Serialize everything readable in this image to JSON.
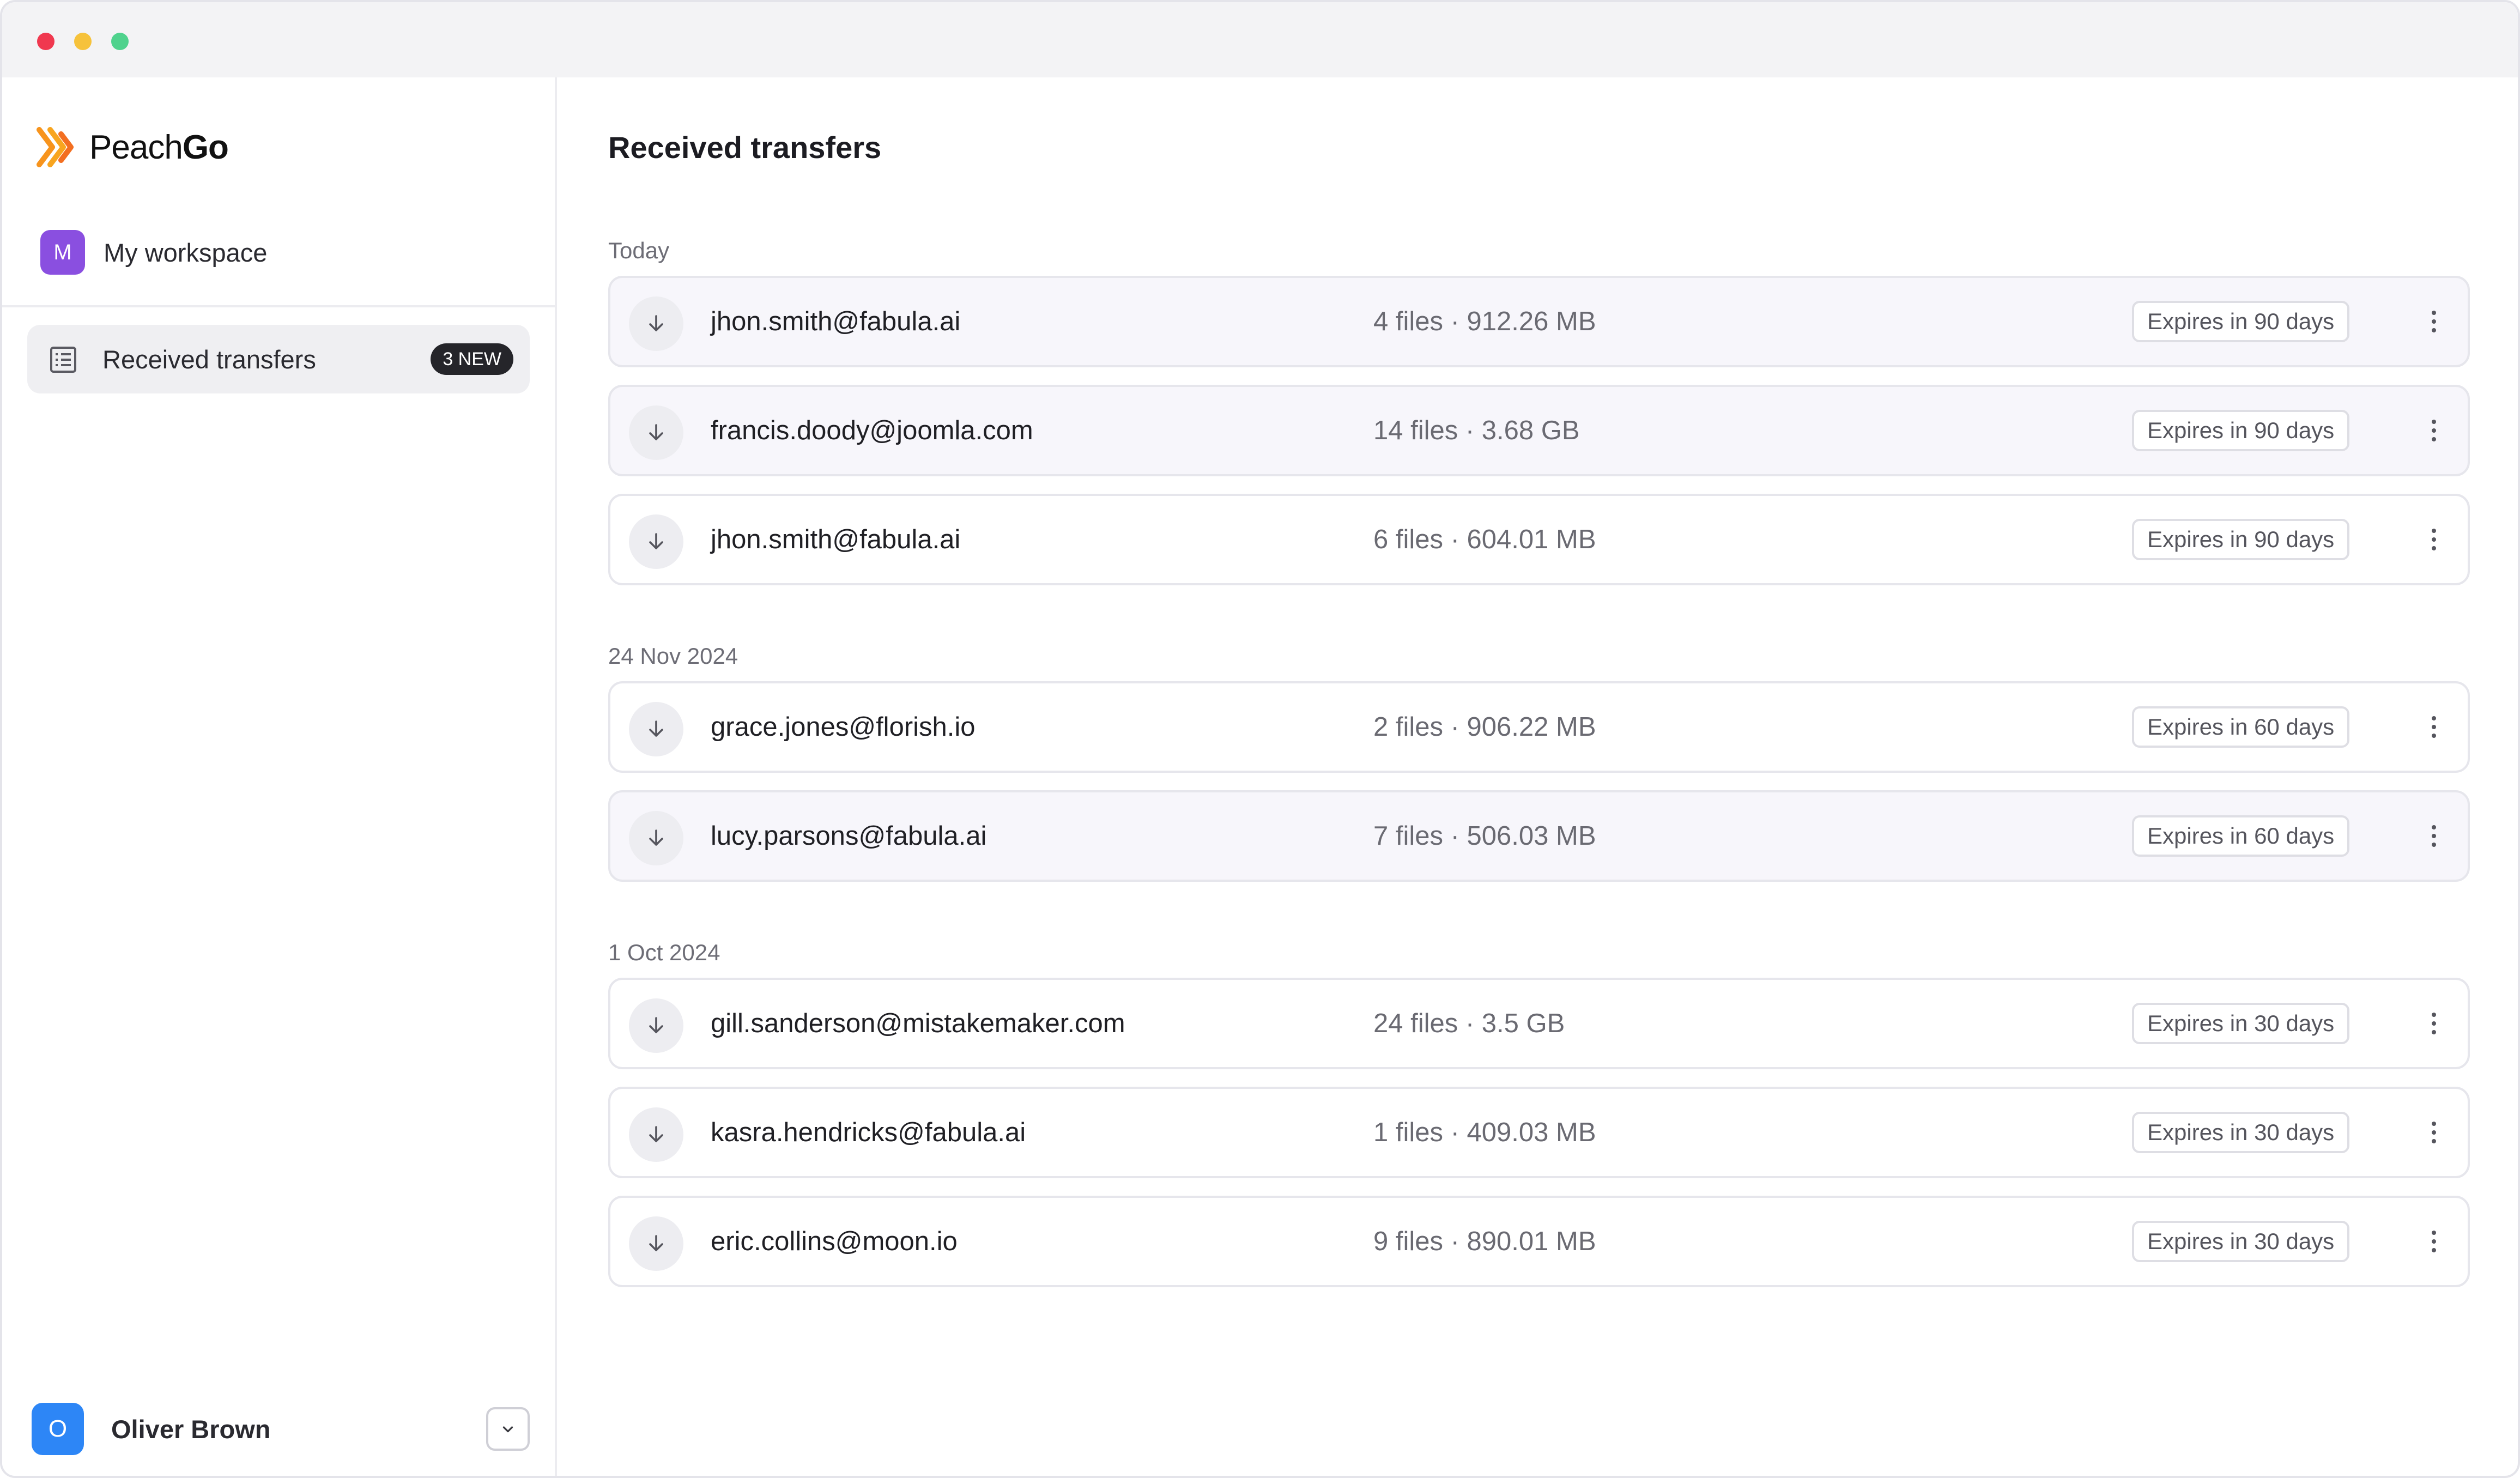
{
  "app": {
    "brand": {
      "name_light": "Peach",
      "name_bold": "Go",
      "icon": "peach-go-logo-icon",
      "accent": "#f7941d"
    }
  },
  "window": {
    "controls": [
      "close",
      "minimize",
      "zoom"
    ]
  },
  "sidebar": {
    "workspace": {
      "initial": "M",
      "label": "My workspace",
      "avatar_color": "#8a4fe0"
    },
    "nav": [
      {
        "label": "Received transfers",
        "badge": "3 NEW",
        "icon": "list-icon",
        "active": true
      }
    ],
    "user": {
      "initial": "O",
      "name": "Oliver Brown",
      "avatar_color": "#2d86f6",
      "menu_icon": "chevron-down-icon"
    }
  },
  "main": {
    "title": "Received transfers",
    "groups": [
      {
        "label": "Today",
        "items": [
          {
            "email": "jhon.smith@fabula.ai",
            "meta": "4 files · 912.26 MB",
            "expires": "Expires in 90 days",
            "tinted": true
          },
          {
            "email": "francis.doody@joomla.com",
            "meta": "14 files · 3.68 GB",
            "expires": "Expires in 90 days",
            "tinted": true
          },
          {
            "email": "jhon.smith@fabula.ai",
            "meta": "6 files · 604.01 MB",
            "expires": "Expires in 90 days",
            "tinted": false
          }
        ]
      },
      {
        "label": "24 Nov 2024",
        "items": [
          {
            "email": "grace.jones@florish.io",
            "meta": "2 files · 906.22 MB",
            "expires": "Expires in 60 days",
            "tinted": false
          },
          {
            "email": "lucy.parsons@fabula.ai",
            "meta": "7 files · 506.03 MB",
            "expires": "Expires in 60 days",
            "tinted": true
          }
        ]
      },
      {
        "label": "1 Oct 2024",
        "items": [
          {
            "email": "gill.sanderson@mistakemaker.com",
            "meta": "24 files · 3.5 GB",
            "expires": "Expires in 30 days",
            "tinted": false
          },
          {
            "email": "kasra.hendricks@fabula.ai",
            "meta": "1 files · 409.03 MB",
            "expires": "Expires in 30 days",
            "tinted": false
          },
          {
            "email": "eric.collins@moon.io",
            "meta": "9 files · 890.01 MB",
            "expires": "Expires in 30 days",
            "tinted": false
          }
        ]
      }
    ]
  }
}
